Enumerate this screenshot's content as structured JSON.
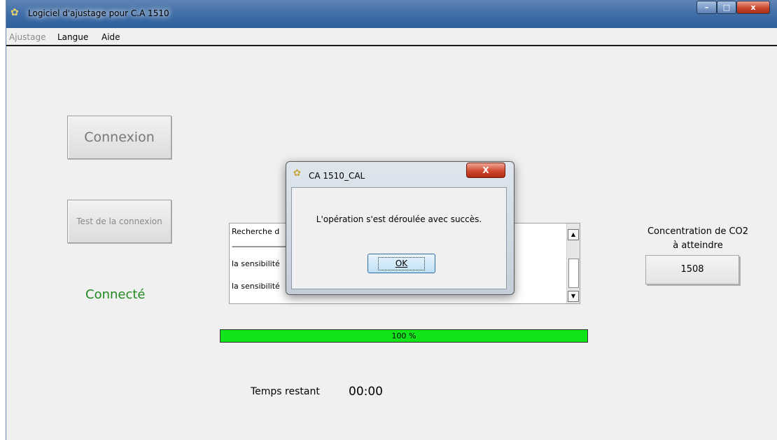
{
  "window": {
    "title": "Logiciel d'ajustage pour C.A 1510",
    "minimize": "–",
    "maximize": "□",
    "close": "x"
  },
  "menu": {
    "items": [
      "Ajustage",
      "Langue",
      "Aide"
    ]
  },
  "buttons": {
    "connexion": "Connexion",
    "test": "Test de la connexion"
  },
  "status": {
    "text": "Connecté",
    "color": "#1f8a1f"
  },
  "log": {
    "lines": [
      "Recherche d",
      "-----------------------------------",
      "la sensibilité",
      "la sensibilité"
    ]
  },
  "progress": {
    "value": 100,
    "label": "100 %",
    "color": "#11e51a"
  },
  "time": {
    "label": "Temps restant",
    "value": "00:00"
  },
  "co2": {
    "label_line1": "Concentration de CO2",
    "label_line2": "à atteindre",
    "value": "1508"
  },
  "dialog": {
    "title": "CA 1510_CAL",
    "message": "L'opération s'est déroulée avec succès.",
    "ok": "OK",
    "close": "X"
  },
  "icons": {
    "app": "app-icon",
    "dialog": "app-icon",
    "scroll_up": "arrow-up-icon",
    "scroll_down": "arrow-down-icon"
  }
}
